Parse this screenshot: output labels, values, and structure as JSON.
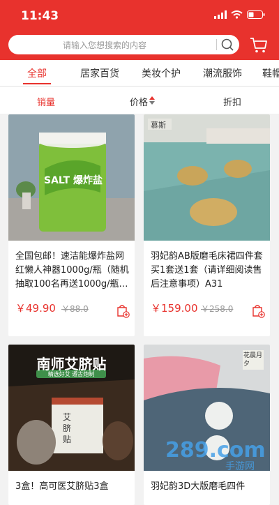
{
  "status": {
    "time": "11:43"
  },
  "search": {
    "placeholder": "请输入您想搜索的内容"
  },
  "tabs": [
    {
      "label": "全部"
    },
    {
      "label": "居家百货"
    },
    {
      "label": "美妆个护"
    },
    {
      "label": "潮流服饰"
    },
    {
      "label": "鞋帽"
    }
  ],
  "sort": {
    "sales": "销量",
    "price": "价格",
    "discount": "折扣"
  },
  "products": [
    {
      "title": "全国包邮！速洁能爆炸盐网红懒人神器1000g/瓶（随机抽取100名再送1000g/瓶…",
      "price": "￥49.90",
      "original": "￥88.0",
      "image_text": "SALT 爆炸盐"
    },
    {
      "title": "羽妃韵AB版磨毛床裙四件套买1套送1套（请详细阅读售后注意事项）A31",
      "price": "￥159.00",
      "original": "￥258.0",
      "image_text": "慕斯"
    },
    {
      "title": "3盒！高可医艾脐贴3盒",
      "image_text": "南师艾脐贴",
      "image_sub": "精选好艾 遵古炮制",
      "box_text": "艾脐贴"
    },
    {
      "title": "羽妃韵3D大版磨毛四件",
      "image_text": "花晨月夕"
    }
  ],
  "watermark": {
    "text": "289.com",
    "sub": "手游网"
  },
  "colors": {
    "brand": "#e8322d"
  }
}
